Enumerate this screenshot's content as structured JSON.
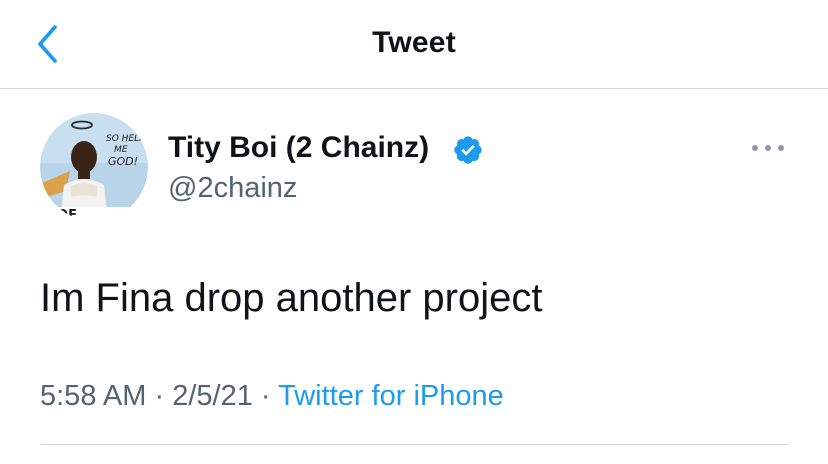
{
  "header": {
    "title": "Tweet",
    "back_icon": "chevron-left-icon"
  },
  "author": {
    "display_name": "Tity Boi (2 Chainz)",
    "handle": "@2chainz",
    "verified": true,
    "avatar_text": "SO HELP ME GOD!",
    "avatar_corner_text": "OOF"
  },
  "tweet": {
    "text": "Im Fina drop another project",
    "time": "5:58 AM",
    "separator": "·",
    "date": "2/5/21",
    "source": "Twitter for iPhone"
  },
  "colors": {
    "accent": "#1d9bf0",
    "secondary_text": "#536471",
    "primary_text": "#0f1419",
    "divider": "#cfd9de"
  }
}
